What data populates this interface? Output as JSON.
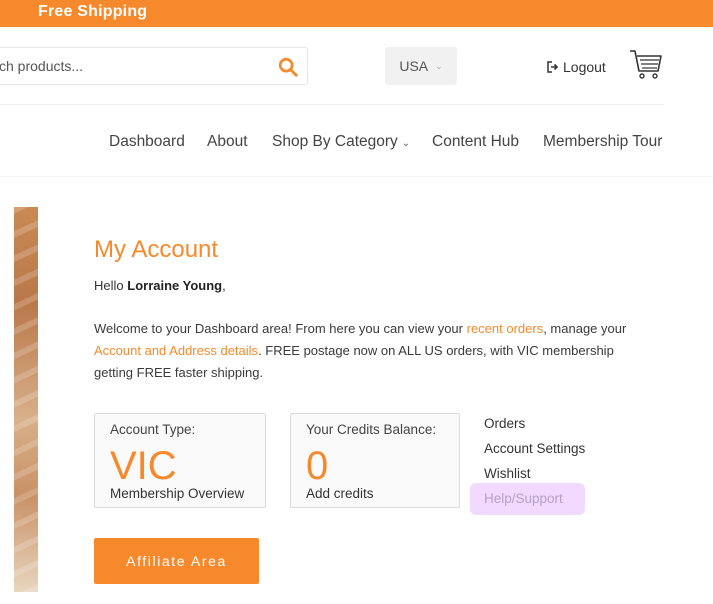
{
  "promo_bar": {
    "text": "Free Shipping"
  },
  "header": {
    "search": {
      "placeholder": "ch products..."
    },
    "region": {
      "selected": "USA"
    },
    "logout_label": "Logout"
  },
  "nav": {
    "items": [
      {
        "label": "Dashboard"
      },
      {
        "label": "About"
      },
      {
        "label": "Shop By Category"
      },
      {
        "label": "Content Hub"
      },
      {
        "label": "Membership Tour"
      }
    ]
  },
  "account": {
    "title": "My Account",
    "greeting_prefix": "Hello ",
    "user_name": "Lorraine Young",
    "greeting_suffix": ",",
    "welcome": {
      "part1": "Welcome to your Dashboard area! From here you can view your ",
      "link1": "recent orders",
      "part2": ", manage your ",
      "link2": "Account and Address details",
      "part3": ". FREE postage now on ALL US orders, with VIC membership getting FREE faster shipping."
    },
    "cards": [
      {
        "label": "Account Type:",
        "value": "VIC",
        "link": "Membership Overview"
      },
      {
        "label": "Your Credits Balance:",
        "value": "0",
        "link": "Add credits"
      }
    ],
    "links": [
      "Orders",
      "Account Settings",
      "Wishlist",
      "Help/Support"
    ],
    "affiliate_label": "Affiliate Area"
  },
  "colors": {
    "accent": "#f6892b",
    "highlight": "#e8baff"
  }
}
